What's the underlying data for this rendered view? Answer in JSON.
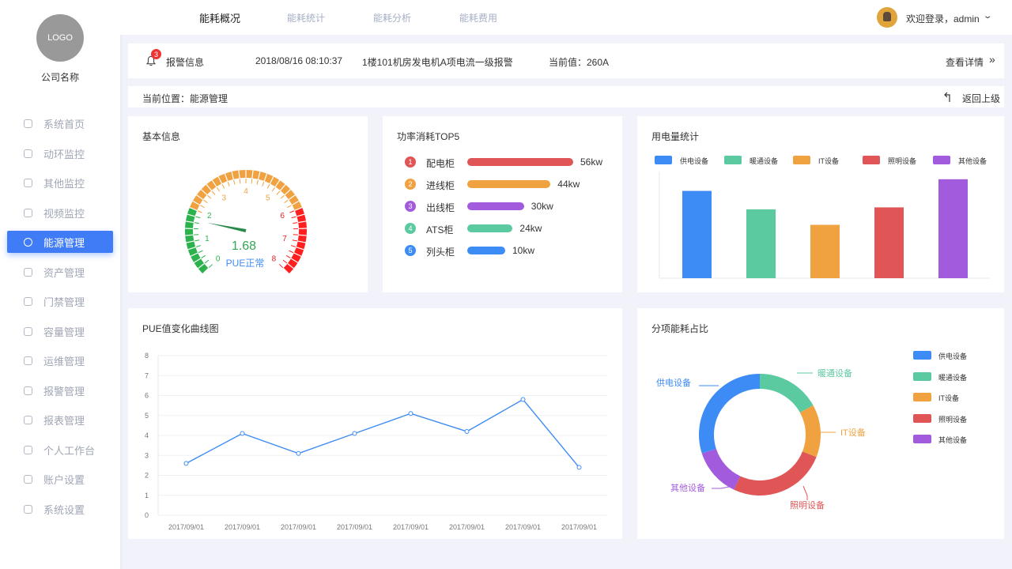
{
  "company": {
    "logo": "LOGO",
    "name": "公司名称"
  },
  "sidebar": {
    "items": [
      {
        "label": "系统首页",
        "icon": "home-icon"
      },
      {
        "label": "动环监控",
        "icon": "monitor-icon"
      },
      {
        "label": "其他监控",
        "icon": "eye-icon"
      },
      {
        "label": "视频监控",
        "icon": "camera-icon"
      },
      {
        "label": "能源管理",
        "icon": "energy-icon",
        "active": true
      },
      {
        "label": "资产管理",
        "icon": "folder-icon"
      },
      {
        "label": "门禁管理",
        "icon": "lock-icon"
      },
      {
        "label": "容量管理",
        "icon": "capacity-icon"
      },
      {
        "label": "运维管理",
        "icon": "ops-icon"
      },
      {
        "label": "报警管理",
        "icon": "alarm-icon"
      },
      {
        "label": "报表管理",
        "icon": "report-icon"
      },
      {
        "label": "个人工作台",
        "icon": "desktop-icon"
      },
      {
        "label": "账户设置",
        "icon": "user-icon"
      },
      {
        "label": "系统设置",
        "icon": "gear-icon"
      }
    ]
  },
  "topbar": {
    "tabs": [
      {
        "label": "能耗概况",
        "active": true
      },
      {
        "label": "能耗统计"
      },
      {
        "label": "能耗分析"
      },
      {
        "label": "能耗费用"
      }
    ],
    "welcome": "欢迎登录，admin"
  },
  "alarm": {
    "badge": "3",
    "label": "报警信息",
    "time": "2018/08/16  08:10:37",
    "message": "1楼101机房发电机A项电流一级报警",
    "current": "当前值：260A",
    "more": "查看详情"
  },
  "breadcrumb": {
    "text": "当前位置：能源管理",
    "back": "返回上级"
  },
  "basic": {
    "title": "基本信息",
    "gauge_value": "1.68",
    "gauge_status": "PUE正常",
    "ticks": [
      "0",
      "1",
      "2",
      "3",
      "4",
      "5",
      "6",
      "7",
      "8"
    ]
  },
  "top5": {
    "title": "功率消耗TOP5",
    "items": [
      {
        "rank": "1",
        "name": "配电柜",
        "value": "56kw",
        "num": 56,
        "color": "#e05555"
      },
      {
        "rank": "2",
        "name": "进线柜",
        "value": "44kw",
        "num": 44,
        "color": "#f0a240"
      },
      {
        "rank": "3",
        "name": "出线柜",
        "value": "30kw",
        "num": 30,
        "color": "#a35bdd"
      },
      {
        "rank": "4",
        "name": "ATS柜",
        "value": "24kw",
        "num": 24,
        "color": "#5ccaa0"
      },
      {
        "rank": "5",
        "name": "列头柜",
        "value": "10kw",
        "num": 10,
        "color": "#3d8bf5"
      }
    ]
  },
  "usage": {
    "title": "用电量统计",
    "legend": [
      "供电设备",
      "暖通设备",
      "IT设备",
      "照明设备",
      "其他设备"
    ],
    "colors": [
      "#3d8bf5",
      "#5ccaa0",
      "#f0a240",
      "#e05555",
      "#a35bdd"
    ]
  },
  "pue_chart": {
    "title": "PUE值变化曲线图"
  },
  "ratio": {
    "title": "分项能耗占比",
    "legend": [
      "供电设备",
      "暖通设备",
      "IT设备",
      "照明设备",
      "其他设备"
    ],
    "labels": [
      "供电设备",
      "暖通设备",
      "IT设备",
      "照明设备",
      "其他设备"
    ],
    "colors": [
      "#3d8bf5",
      "#5ccaa0",
      "#f0a240",
      "#e05555",
      "#a35bdd"
    ]
  },
  "chart_data": [
    {
      "type": "bar",
      "title": "用电量统计",
      "categories": [
        "供电设备",
        "暖通设备",
        "IT设备",
        "照明设备",
        "其他设备"
      ],
      "values": [
        90,
        71,
        55,
        73,
        102
      ],
      "ylim": [
        0,
        110
      ],
      "grid": false,
      "legend": "top"
    },
    {
      "type": "line",
      "title": "PUE值变化曲线图",
      "x": [
        "2017/09/01",
        "2017/09/01",
        "2017/09/01",
        "2017/09/01",
        "2017/09/01",
        "2017/09/01",
        "2017/09/01",
        "2017/09/01"
      ],
      "yticks": [
        "0",
        "1",
        "2",
        "3",
        "4",
        "5",
        "6",
        "7",
        "8"
      ],
      "series": [
        {
          "values": [
            2.6,
            4.1,
            3.1,
            4.1,
            5.1,
            4.2,
            5.8,
            2.4
          ]
        }
      ],
      "ylim": [
        0,
        8
      ],
      "grid": true
    },
    {
      "type": "pie",
      "title": "分项能耗占比",
      "categories": [
        "供电设备",
        "暖通设备",
        "IT设备",
        "照明设备",
        "其他设备"
      ],
      "values": [
        30,
        17,
        14,
        26,
        13
      ],
      "legend": "right"
    }
  ]
}
